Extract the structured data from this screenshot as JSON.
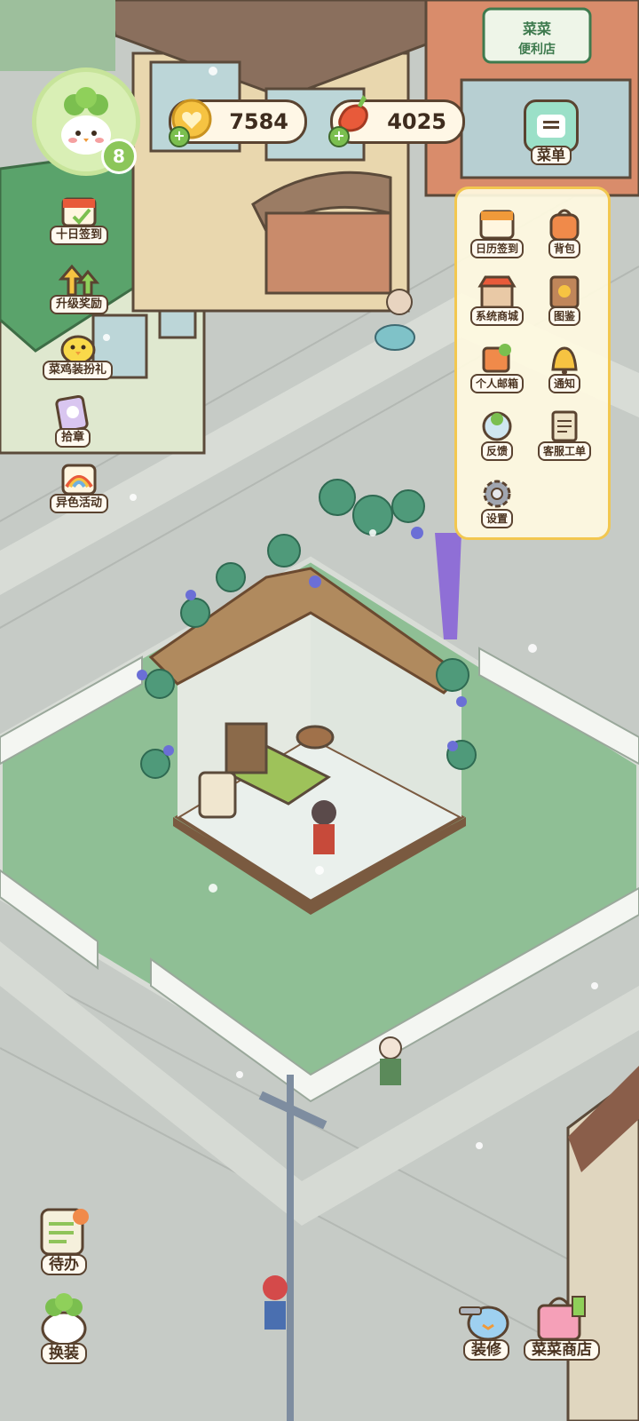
{
  "player": {
    "level": "8"
  },
  "currency": {
    "coins": "7584",
    "carrots": "4025"
  },
  "menu_button": {
    "label": "菜单"
  },
  "left_sidebar": [
    {
      "label": "十日签到",
      "icon": "calendar-gift-icon"
    },
    {
      "label": "升级奖励",
      "icon": "level-up-arrows-icon"
    },
    {
      "label": "菜鸡装扮礼",
      "icon": "chick-outfit-icon"
    },
    {
      "label": "拾章",
      "icon": "badge-card-icon"
    },
    {
      "label": "异色活动",
      "icon": "rainbow-event-icon"
    }
  ],
  "menu_panel": [
    {
      "label": "日历签到",
      "icon": "calendar-icon"
    },
    {
      "label": "背包",
      "icon": "backpack-icon"
    },
    {
      "label": "系统商城",
      "icon": "shop-icon"
    },
    {
      "label": "图鉴",
      "icon": "album-icon"
    },
    {
      "label": "个人邮箱",
      "icon": "mailbox-icon"
    },
    {
      "label": "通知",
      "icon": "bell-icon"
    },
    {
      "label": "反馈",
      "icon": "feedback-icon"
    },
    {
      "label": "客服工单",
      "icon": "service-ticket-icon"
    },
    {
      "label": "设置",
      "icon": "gear-icon"
    }
  ],
  "bottom_left": [
    {
      "label": "待办",
      "icon": "todo-list-icon"
    },
    {
      "label": "换装",
      "icon": "outfit-change-icon"
    }
  ],
  "bottom_right": [
    {
      "label": "装修",
      "icon": "decorate-icon"
    },
    {
      "label": "菜菜商店",
      "icon": "store-bag-icon"
    }
  ],
  "scene": {
    "store_sign_line1": "菜菜",
    "store_sign_line2": "便利店"
  },
  "colors": {
    "grass": "#8fbf95",
    "panel_border": "#f2c750",
    "text_dark": "#4a3320"
  }
}
